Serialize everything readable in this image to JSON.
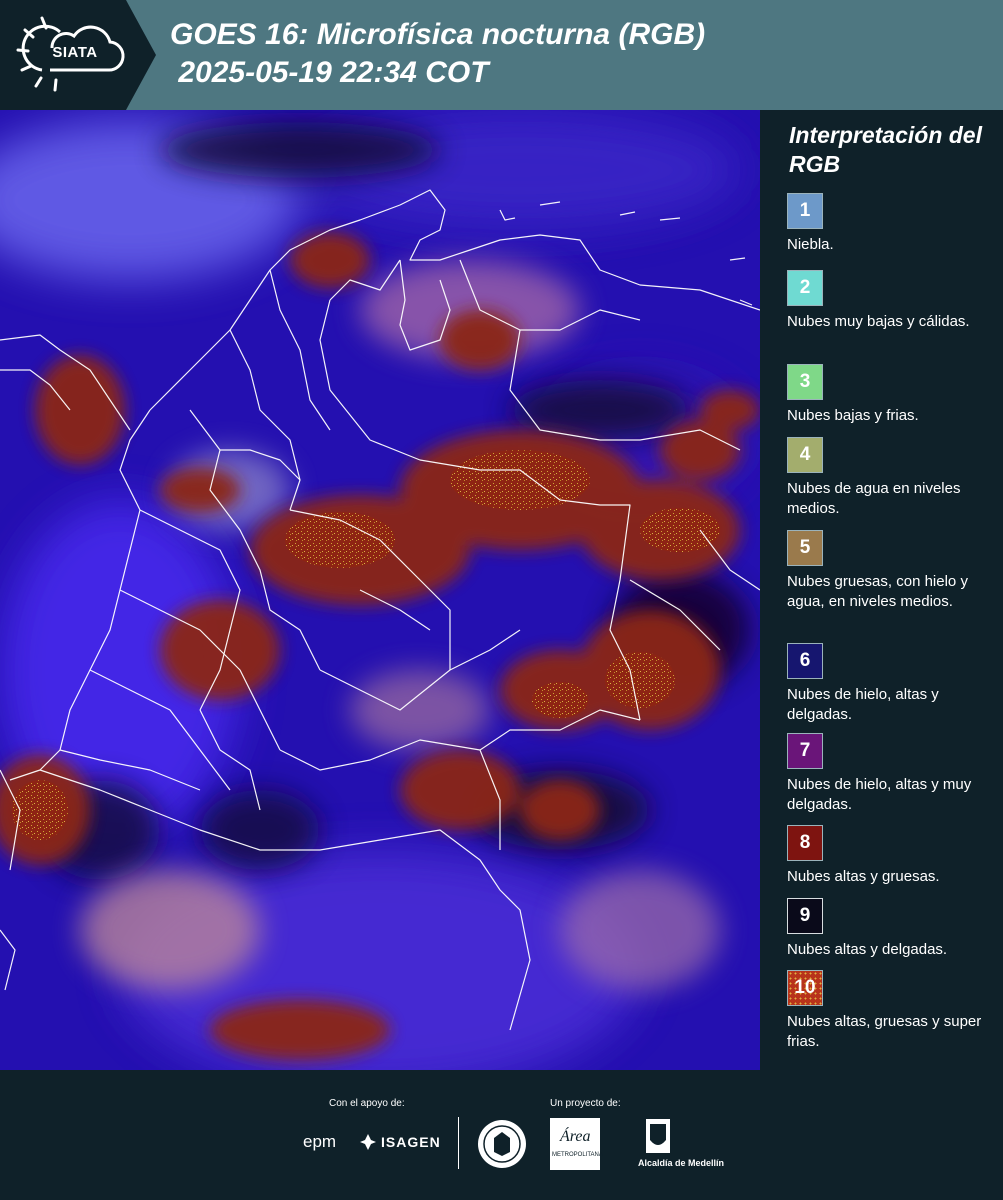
{
  "header": {
    "logo_text": "SIATA",
    "title": "GOES 16: Microfísica nocturna (RGB)\n 2025-05-19 22:34 COT"
  },
  "colors": {
    "header_bg": "#4e7781",
    "panel_bg": "#0f2129",
    "map_ocean": "#1b0f9b",
    "thick_cloud": "#8b2612"
  },
  "legend": {
    "title": "Interpretación del RGB",
    "items": [
      {
        "num": "1",
        "label": "Niebla.",
        "color": "#6d99c9"
      },
      {
        "num": "2",
        "label": "Nubes muy bajas y cálidas.",
        "color": "#6fdad2"
      },
      {
        "num": "3",
        "label": "Nubes bajas y frias.",
        "color": "#7fd888"
      },
      {
        "num": "4",
        "label": "Nubes de agua en niveles medios.",
        "color": "#a3ad6d"
      },
      {
        "num": "5",
        "label": "Nubes gruesas, con hielo y agua, en niveles medios.",
        "color": "#9a7a4c"
      },
      {
        "num": "6",
        "label": "Nubes de hielo, altas y delgadas.",
        "color": "#16166f"
      },
      {
        "num": "7",
        "label": "Nubes de hielo, altas y muy delgadas.",
        "color": "#6a1579"
      },
      {
        "num": "8",
        "label": "Nubes altas y gruesas.",
        "color": "#7e1410"
      },
      {
        "num": "9",
        "label": "Nubes altas y delgadas.",
        "color": "#0a0a1a"
      },
      {
        "num": "10",
        "label": "Nubes altas, gruesas y super frias.",
        "color": "#b8331b"
      }
    ]
  },
  "footer": {
    "support_label": "Con el apoyo de:",
    "project_label": "Un proyecto de:",
    "sponsor_epm": "epm",
    "sponsor_isagen": "ISAGEN",
    "area_label": "Área",
    "metropolitana_label": "METROPOLITANA",
    "alcaldia_label": "Alcaldía de Medellín"
  }
}
